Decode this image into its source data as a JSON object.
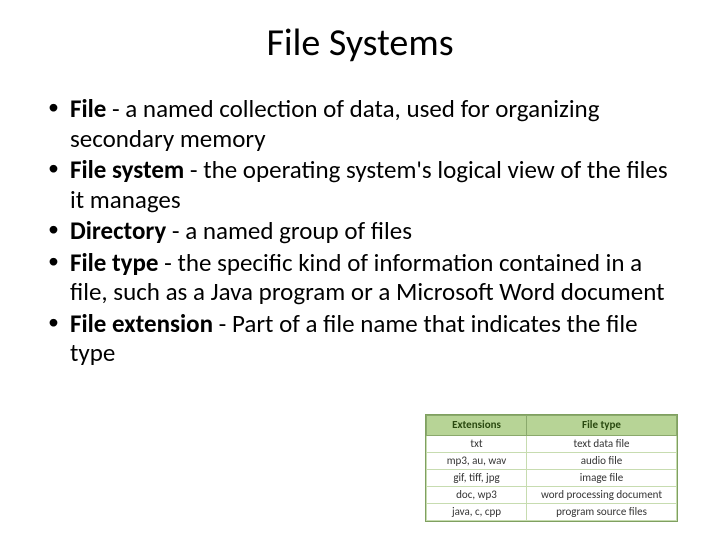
{
  "title": "File Systems",
  "bullets": [
    {
      "term": "File",
      "rest": " - a named collection of data, used for organizing secondary memory"
    },
    {
      "term": "File system",
      "rest": " - the operating system's logical view of the files it manages"
    },
    {
      "term": "Directory",
      "rest": " -  a named group of files"
    },
    {
      "term": "File type",
      "rest": " - the specific kind of information contained in a file, such as a Java program or a Microsoft Word document"
    },
    {
      "term": "File extension",
      "rest": " - Part of a file name that indicates the file type"
    }
  ],
  "table": {
    "headers": {
      "ext": "Extensions",
      "type": "File type"
    },
    "rows": [
      {
        "ext": "txt",
        "type": "text data file"
      },
      {
        "ext": "mp3, au, wav",
        "type": "audio file"
      },
      {
        "ext": "gif, tiff, jpg",
        "type": "image file"
      },
      {
        "ext": "doc, wp3",
        "type": "word processing document"
      },
      {
        "ext": "java, c, cpp",
        "type": "program source files"
      }
    ]
  }
}
